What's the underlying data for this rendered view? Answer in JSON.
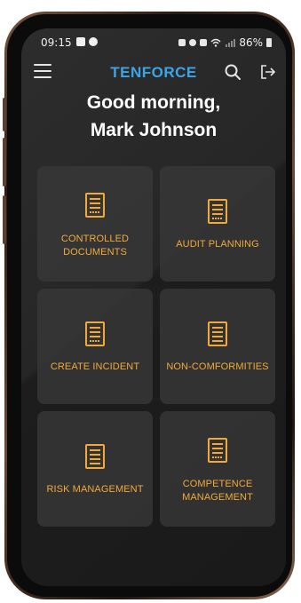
{
  "status_bar": {
    "time": "09:15",
    "battery": "86%"
  },
  "header": {
    "brand": "TENFORCE",
    "icons": [
      "menu-icon",
      "search-icon",
      "logout-icon"
    ]
  },
  "greeting": {
    "line1": "Good morning,",
    "line2": "Mark Johnson"
  },
  "tiles": [
    {
      "label_line1": "CONTROLLED",
      "label_line2": "DOCUMENTS",
      "icon": "document-icon"
    },
    {
      "label_line1": "AUDIT PLANNING",
      "label_line2": "",
      "icon": "document-icon"
    },
    {
      "label_line1": "CREATE INCIDENT",
      "label_line2": "",
      "icon": "document-icon"
    },
    {
      "label_line1": "NON-COMFORMITIES",
      "label_line2": "",
      "icon": "document-icon"
    },
    {
      "label_line1": "RISK MANAGEMENT",
      "label_line2": "",
      "icon": "document-icon"
    },
    {
      "label_line1": "COMPETENCE",
      "label_line2": "MANAGEMENT",
      "icon": "document-icon"
    }
  ],
  "colors": {
    "brand": "#3aa6e8",
    "tile_label": "#f2a93b",
    "tile_bg": "#3a3a3a",
    "screen_bg": "#222222"
  }
}
